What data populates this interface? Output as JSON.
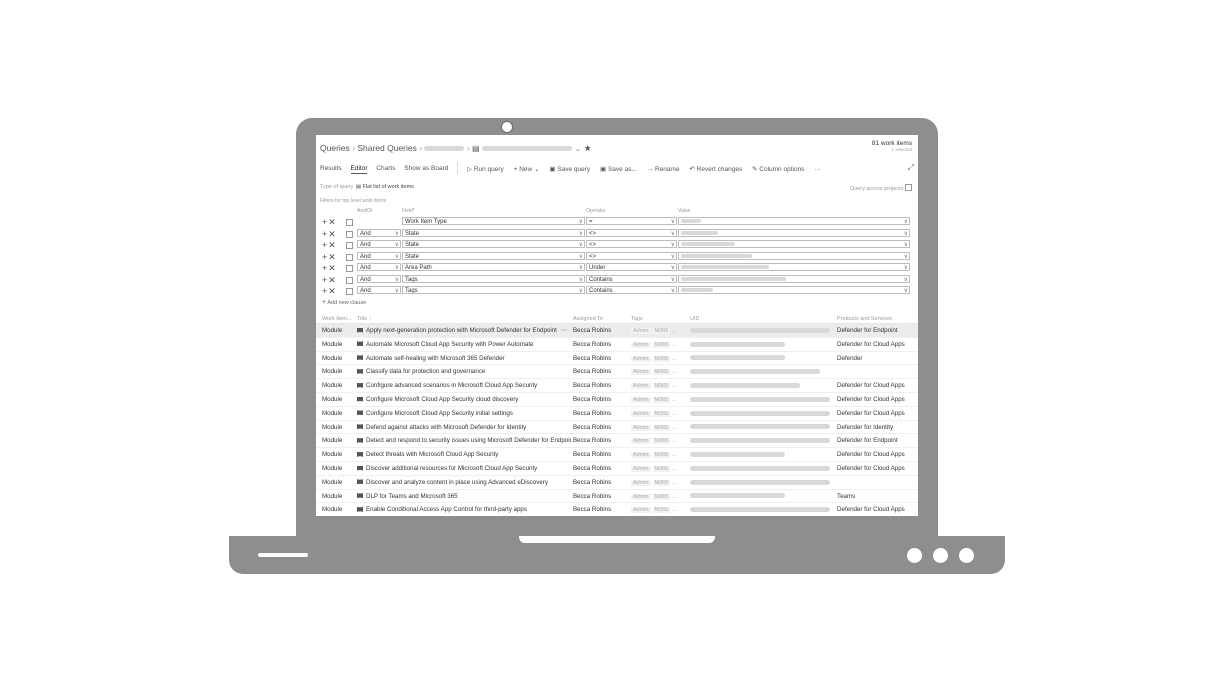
{
  "breadcrumb": {
    "queries": "Queries",
    "shared_queries": "Shared Queries",
    "star_icon": "star-icon"
  },
  "count": {
    "items": "81 work items",
    "selected": "1 selected"
  },
  "toolbar": {
    "tabs": [
      "Results",
      "Editor",
      "Charts",
      "Show as Board"
    ],
    "active_tab": "Editor",
    "run_query": "Run query",
    "new": "New",
    "save_query": "Save query",
    "save_as": "Save as...",
    "rename": "Rename",
    "revert": "Revert changes",
    "column_options": "Column options",
    "more": "···"
  },
  "query": {
    "type_label": "Type of query",
    "type_value": "Flat list of work items",
    "across_projects": "Query across projects",
    "filters_label": "Filters for top level work items",
    "col_andor": "And/Or",
    "col_field": "Field*",
    "col_operator": "Operator",
    "col_value": "Value",
    "add_clause": "Add new clause",
    "clauses": [
      {
        "andor": "",
        "field": "Work Item Type",
        "operator": "="
      },
      {
        "andor": "And",
        "field": "State",
        "operator": "<>"
      },
      {
        "andor": "And",
        "field": "State",
        "operator": "<>"
      },
      {
        "andor": "And",
        "field": "State",
        "operator": "<>"
      },
      {
        "andor": "And",
        "field": "Area Path",
        "operator": "Under"
      },
      {
        "andor": "And",
        "field": "Tags",
        "operator": "Contains"
      },
      {
        "andor": "And",
        "field": "Tags",
        "operator": "Contains"
      }
    ]
  },
  "results": {
    "headers": {
      "type": "Work Item...",
      "title": "Title",
      "assigned": "Assigned To",
      "tags": "Tags",
      "uid": "UID",
      "products": "Products and Services"
    },
    "tag_labels": [
      "Admin",
      "M365"
    ],
    "rows": [
      {
        "type": "Module",
        "title": "Apply next-generation protection with Microsoft Defender for Endpoint",
        "assigned": "Becca Robins",
        "product": "Defender for Endpoint"
      },
      {
        "type": "Module",
        "title": "Automate Microsoft Cloud App Security with Power Automate",
        "assigned": "Becca Robins",
        "product": "Defender for Cloud Apps"
      },
      {
        "type": "Module",
        "title": "Automate self-healing with Microsoft 365 Defender",
        "assigned": "Becca Robins",
        "product": "Defender"
      },
      {
        "type": "Module",
        "title": "Classify data for protection and governance",
        "assigned": "Becca Robins",
        "product": ""
      },
      {
        "type": "Module",
        "title": "Configure advanced scenarios in Microsoft Cloud App Security",
        "assigned": "Becca Robins",
        "product": "Defender for Cloud Apps"
      },
      {
        "type": "Module",
        "title": "Configure Microsoft Cloud App Security cloud discovery",
        "assigned": "Becca Robins",
        "product": "Defender for Cloud Apps"
      },
      {
        "type": "Module",
        "title": "Configure Microsoft Cloud App Security initial settings",
        "assigned": "Becca Robins",
        "product": "Defender for Cloud Apps"
      },
      {
        "type": "Module",
        "title": "Defend against attacks with Microsoft Defender for Identity",
        "assigned": "Becca Robins",
        "product": "Defender for Identity"
      },
      {
        "type": "Module",
        "title": "Detect and respond to security issues using Microsoft Defender for Endpoint",
        "assigned": "Becca Robins",
        "product": "Defender for Endpoint"
      },
      {
        "type": "Module",
        "title": "Detect threats with Microsoft Cloud App Security",
        "assigned": "Becca Robins",
        "product": "Defender for Cloud Apps"
      },
      {
        "type": "Module",
        "title": "Discover additional resources for Microsoft Cloud App Security",
        "assigned": "Becca Robins",
        "product": "Defender for Cloud Apps"
      },
      {
        "type": "Module",
        "title": "Discover and analyze content in place using Advanced eDiscovery",
        "assigned": "Becca Robins",
        "product": ""
      },
      {
        "type": "Module",
        "title": "DLP for Teams and Microsoft 365",
        "assigned": "Becca Robins",
        "product": "Teams"
      },
      {
        "type": "Module",
        "title": "Enable Conditional Access App Control for third-party apps",
        "assigned": "Becca Robins",
        "product": "Defender for Cloud Apps"
      }
    ]
  }
}
